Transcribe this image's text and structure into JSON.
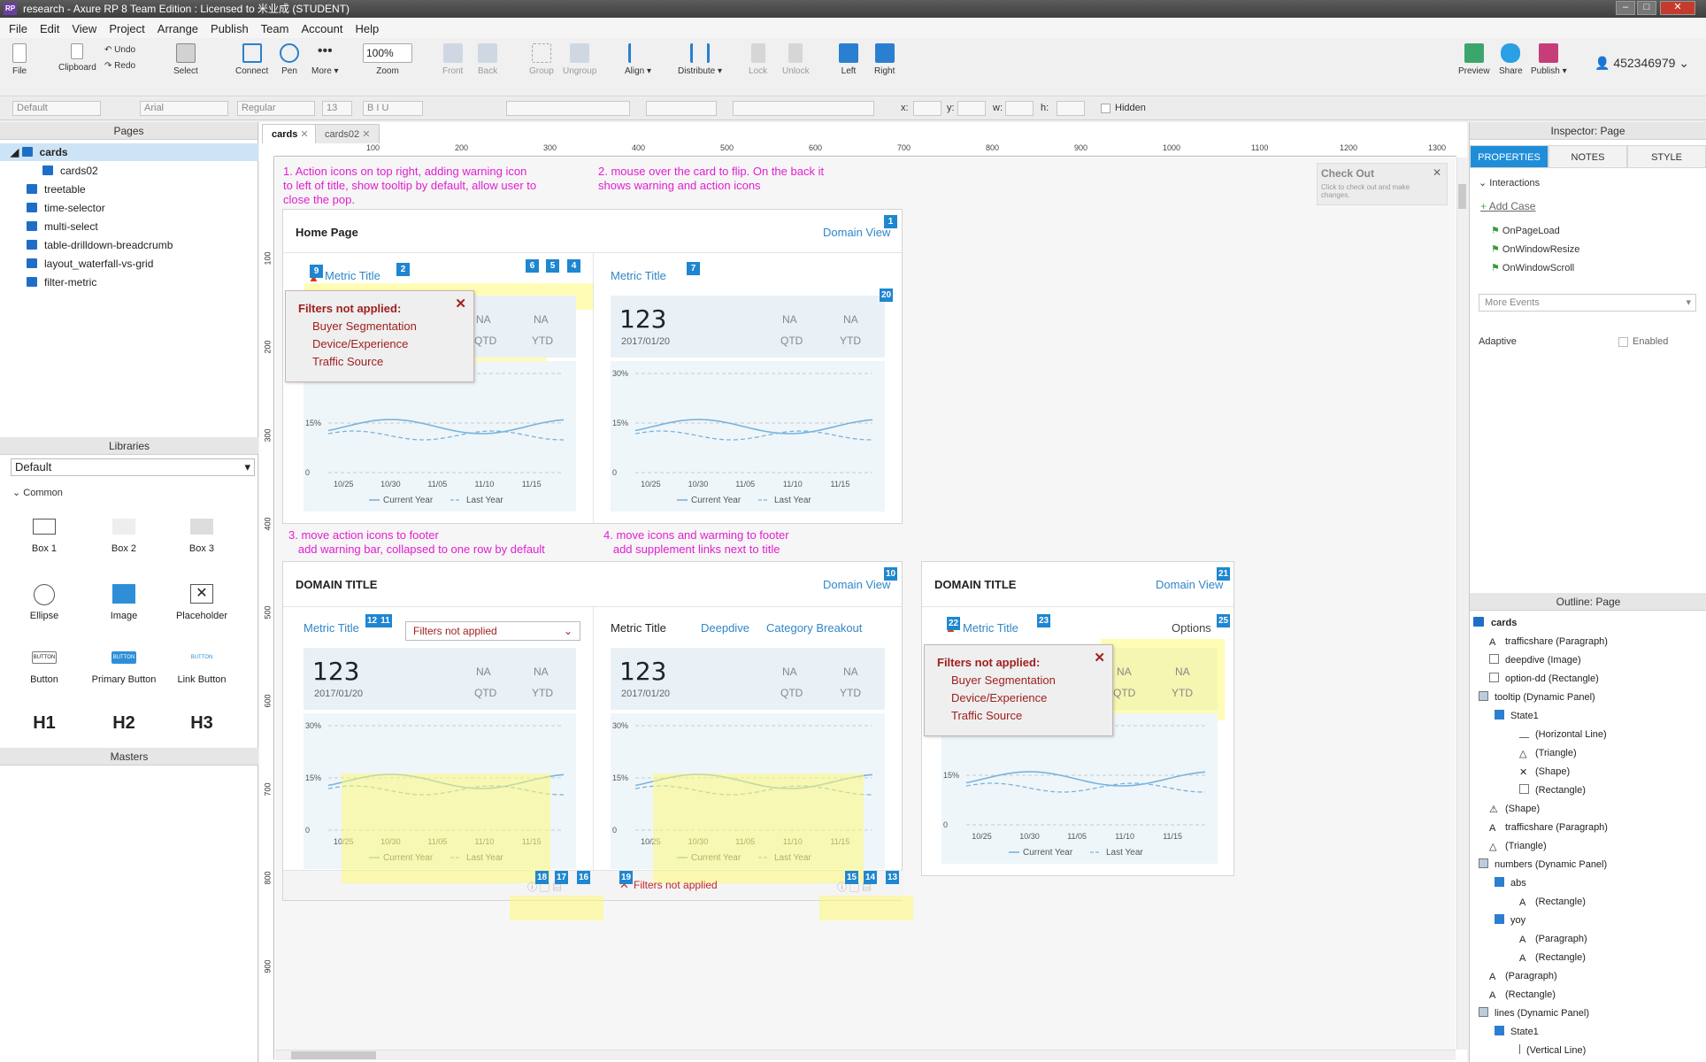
{
  "window": {
    "title": "research - Axure RP 8 Team Edition : Licensed to 米业成 (STUDENT)",
    "logo": "RP"
  },
  "menu": [
    "File",
    "Edit",
    "View",
    "Project",
    "Arrange",
    "Publish",
    "Team",
    "Account",
    "Help"
  ],
  "toolbar": {
    "file": "File",
    "clipboard": "Clipboard",
    "undo": "Undo",
    "redo": "Redo",
    "select": "Select",
    "connect": "Connect",
    "pen": "Pen",
    "more": "More ▾",
    "zoom_value": "100%",
    "zoom": "Zoom",
    "front": "Front",
    "back": "Back",
    "group": "Group",
    "ungroup": "Ungroup",
    "align": "Align ▾",
    "distribute": "Distribute ▾",
    "lock": "Lock",
    "unlock": "Unlock",
    "left": "Left",
    "right": "Right",
    "preview": "Preview",
    "share": "Share",
    "publish": "Publish ▾",
    "user": "452346979"
  },
  "format": {
    "style": "Default",
    "font": "Arial",
    "weight": "Regular",
    "size": "13",
    "x": "x:",
    "y": "y:",
    "w": "w:",
    "h": "h:",
    "hidden": "Hidden"
  },
  "pages": {
    "header": "Pages",
    "items": [
      "cards",
      "cards02",
      "treetable",
      "time-selector",
      "multi-select",
      "table-drilldown-breadcrumb",
      "layout_waterfall-vs-grid",
      "filter-metric"
    ]
  },
  "libraries": {
    "header": "Libraries",
    "selected": "Default",
    "group": "Common",
    "widgets": [
      "Box 1",
      "Box 2",
      "Box 3",
      "Ellipse",
      "Image",
      "Placeholder",
      "Button",
      "Primary Button",
      "Link Button",
      "H1",
      "H2",
      "H3"
    ],
    "button_text": "BUTTON"
  },
  "masters": {
    "header": "Masters"
  },
  "tabs": [
    "cards",
    "cards02"
  ],
  "ruler": [
    "100",
    "200",
    "300",
    "400",
    "500",
    "600",
    "700",
    "800",
    "900",
    "1000",
    "1100",
    "1200",
    "1300"
  ],
  "ruler_v": [
    "100",
    "200",
    "300",
    "400",
    "500",
    "600",
    "700",
    "800",
    "900"
  ],
  "notes": {
    "n1": [
      "1. Action icons on top right, adding warning icon",
      "to left of title, show tooltip by default, allow user to",
      "close the pop."
    ],
    "n2": [
      "2. mouse over the card to flip. On the back it",
      "shows warning and action icons"
    ],
    "n3": [
      "3. move action icons to footer",
      "   add warning bar, collapsed to one row by default"
    ],
    "n4": [
      "4. move icons and warming to footer",
      "   add supplement links next to title"
    ]
  },
  "checkout": {
    "title": "Check Out",
    "text": "Click to check out and make changes."
  },
  "card1": {
    "title": "Home Page",
    "link": "Domain View",
    "metric": "Metric Title"
  },
  "card2": {
    "title": "DOMAIN TITLE",
    "link": "Domain View",
    "metric": "Metric Title",
    "select": "Filters not applied",
    "deepdive": "Deepdive",
    "category": "Category Breakout",
    "footer_warning": "Filters not applied"
  },
  "card3": {
    "title": "DOMAIN TITLE",
    "link": "Domain View",
    "metric": "Metric Title",
    "options": "Options"
  },
  "metric": {
    "value": "123",
    "date": "2017/01/20",
    "na": "NA",
    "qtd": "QTD",
    "ytd": "YTD"
  },
  "chart_data": {
    "type": "line",
    "x": [
      "10/25",
      "10/30",
      "11/05",
      "11/10",
      "11/15"
    ],
    "yticks": [
      "0",
      "15%",
      "30%"
    ],
    "series": [
      {
        "name": "Current Year"
      },
      {
        "name": "Last Year"
      }
    ]
  },
  "popup": {
    "title": "Filters not applied:",
    "items": [
      "Buyer Segmentation",
      "Device/Experience",
      "Traffic Source"
    ]
  },
  "badges": [
    "1",
    "2",
    "4",
    "5",
    "6",
    "7",
    "9",
    "10",
    "11",
    "12",
    "13",
    "14",
    "15",
    "16",
    "17",
    "18",
    "19",
    "20",
    "21",
    "22",
    "23",
    "25"
  ],
  "inspector": {
    "title": "Inspector: Page",
    "tabs": [
      "PROPERTIES",
      "NOTES",
      "STYLE"
    ],
    "interactions": "Interactions",
    "add_case": "Add Case",
    "events": [
      "OnPageLoad",
      "OnWindowResize",
      "OnWindowScroll"
    ],
    "more_events": "More Events",
    "adaptive": "Adaptive",
    "enabled": "Enabled"
  },
  "outline": {
    "header": "Outline: Page",
    "items": [
      "cards",
      "trafficshare (Paragraph)",
      "deepdive (Image)",
      "option-dd (Rectangle)",
      "tooltip (Dynamic Panel)",
      "State1",
      "(Horizontal Line)",
      "(Triangle)",
      "(Shape)",
      "(Rectangle)",
      "(Shape)",
      "trafficshare (Paragraph)",
      "(Triangle)",
      "numbers (Dynamic Panel)",
      "abs",
      "(Rectangle)",
      "yoy",
      "(Paragraph)",
      "(Rectangle)",
      "(Paragraph)",
      "(Rectangle)",
      "lines (Dynamic Panel)",
      "State1",
      "(Vertical Line)"
    ]
  }
}
